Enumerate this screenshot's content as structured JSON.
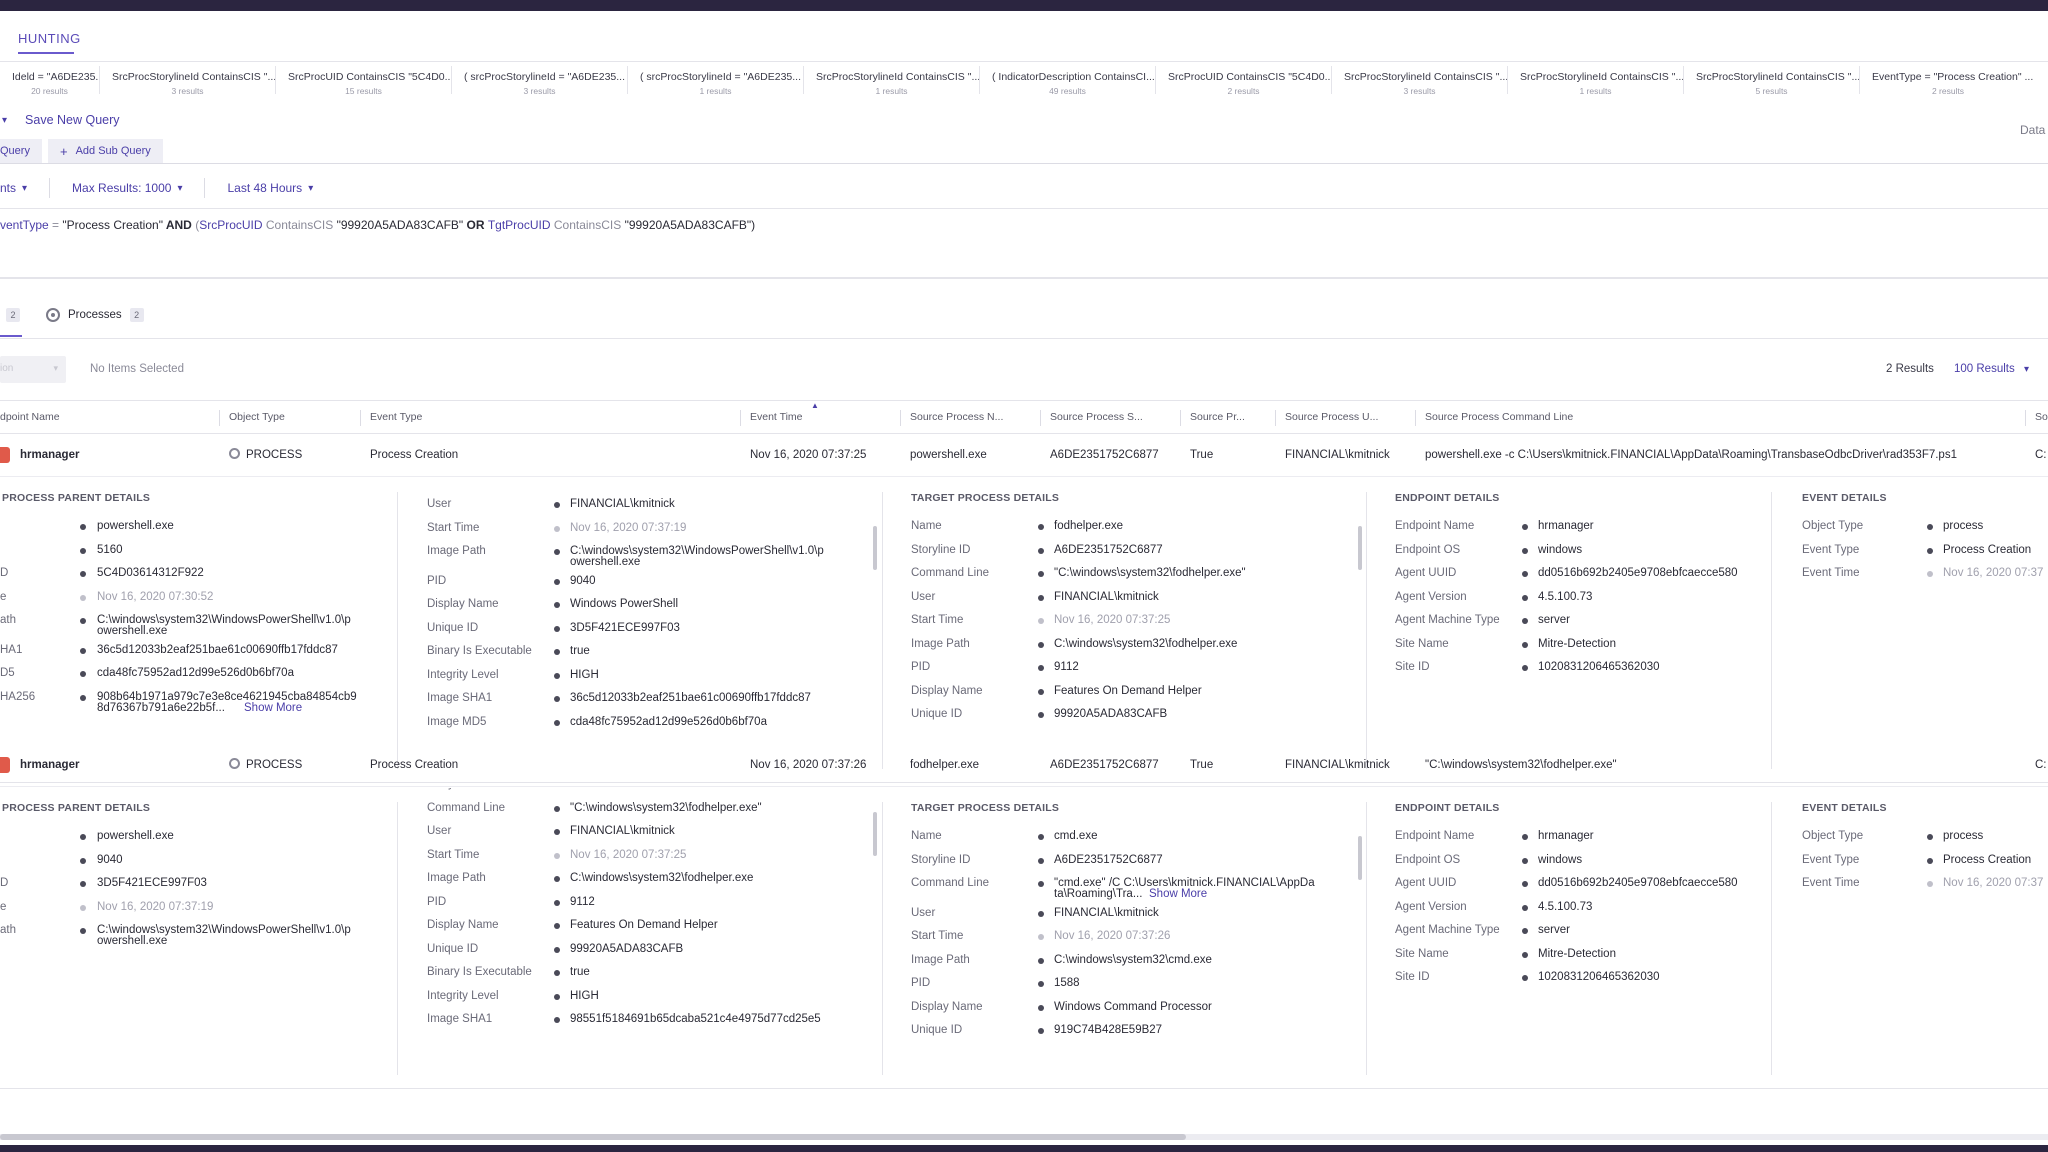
{
  "app": {
    "section_title": "HUNTING"
  },
  "history_tabs": [
    {
      "query": "Ideld = \"A6DE235...",
      "results": "20 results"
    },
    {
      "query": "SrcProcStorylineId ContainsCIS \"...",
      "results": "3 results"
    },
    {
      "query": "SrcProcUID ContainsCIS \"5C4D0...",
      "results": "15 results"
    },
    {
      "query": "( srcProcStorylineId = \"A6DE235...",
      "results": "3 results"
    },
    {
      "query": "( srcProcStorylineId = \"A6DE235...",
      "results": "1 results"
    },
    {
      "query": "SrcProcStorylineId ContainsCIS \"...",
      "results": "1 results"
    },
    {
      "query": "( IndicatorDescription ContainsCI...",
      "results": "49 results"
    },
    {
      "query": "SrcProcUID ContainsCIS \"5C4D0...",
      "results": "2 results"
    },
    {
      "query": "SrcProcStorylineId ContainsCIS \"...",
      "results": "3 results"
    },
    {
      "query": "SrcProcStorylineId ContainsCIS \"...",
      "results": "1 results"
    },
    {
      "query": "SrcProcStorylineId ContainsCIS \"...",
      "results": "5 results"
    },
    {
      "query": "EventType = \"Process Creation\" ...",
      "results": "2 results"
    }
  ],
  "query_actions": {
    "save_new_query": "Save New Query",
    "data_label": "Data"
  },
  "subquery": {
    "query_tab": "Query",
    "add_sub_query": "Add Sub Query"
  },
  "filters": {
    "events": "nts",
    "max_results": "Max Results: 1000",
    "time_range": "Last 48 Hours"
  },
  "query_text": {
    "p1": "ventType",
    "p2": " = ",
    "p3": "\"Process Creation\"",
    "p4": " AND ",
    "p5": "(",
    "p6": "SrcProcUID",
    "p7": " ContainsCIS ",
    "p8": "\"99920A5ADA83CAFB\"",
    "p9": " OR ",
    "p10": "TgtProcUID",
    "p11": " ContainsCIS ",
    "p12": "\"99920A5ADA83CAFB\")"
  },
  "result_tabs": {
    "events_badge": "2",
    "processes_label": "Processes",
    "processes_badge": "2"
  },
  "toolbar": {
    "action_label": "ion",
    "no_items": "No Items Selected",
    "results_count": "2 Results",
    "results_per_page": "100 Results"
  },
  "table": {
    "headers": [
      "dpoint Name",
      "Object Type",
      "Event Type",
      "Event Time",
      "Source Process N...",
      "Source Process S...",
      "Source Pr...",
      "Source Process U...",
      "Source Process Command Line",
      "So"
    ],
    "rows": [
      {
        "endpoint": "hrmanager",
        "object_type": "PROCESS",
        "event_type": "Process Creation",
        "event_time": "Nov 16, 2020 07:37:25",
        "src_name": "powershell.exe",
        "src_storyline": "A6DE2351752C6877",
        "src_pr": "True",
        "src_user": "FINANCIAL\\kmitnick",
        "src_cmd": "powershell.exe -c C:\\Users\\kmitnick.FINANCIAL\\AppData\\Roaming\\TransbaseOdbcDriver\\rad353F7.ps1",
        "extra": "C:",
        "parent": {
          "title": "PROCESS PARENT DETAILS",
          "items": [
            {
              "k": "",
              "v": "powershell.exe"
            },
            {
              "k": "",
              "v": "5160"
            },
            {
              "k": "D",
              "v": "5C4D03614312F922"
            },
            {
              "k": "e",
              "v": "Nov 16, 2020 07:30:52"
            },
            {
              "k": "ath",
              "v": "C:\\windows\\system32\\WindowsPowerShell\\v1.0\\p",
              "v2": "owershell.exe"
            },
            {
              "k": "HA1",
              "v": "36c5d12033b2eaf251bae61c00690ffb17fddc87"
            },
            {
              "k": "D5",
              "v": "cda48fc75952ad12d99e526d0b6bf70a"
            },
            {
              "k": "HA256",
              "v": "908b64b1971a979c7e3e8ce4621945cba84854cb9",
              "v2": "8d76367b791a6e22b5f...",
              "more": "Show More"
            }
          ]
        },
        "source": {
          "items": [
            {
              "k": "User",
              "v": "FINANCIAL\\kmitnick"
            },
            {
              "k": "Start Time",
              "v": "Nov 16, 2020 07:37:19"
            },
            {
              "k": "Image Path",
              "v": "C:\\windows\\system32\\WindowsPowerShell\\v1.0\\p",
              "v2": "owershell.exe"
            },
            {
              "k": "PID",
              "v": "9040"
            },
            {
              "k": "Display Name",
              "v": "Windows PowerShell"
            },
            {
              "k": "Unique ID",
              "v": "3D5F421ECE997F03"
            },
            {
              "k": "Binary Is Executable",
              "v": "true"
            },
            {
              "k": "Integrity Level",
              "v": "HIGH"
            },
            {
              "k": "Image SHA1",
              "v": "36c5d12033b2eaf251bae61c00690ffb17fddc87"
            },
            {
              "k": "Image MD5",
              "v": "cda48fc75952ad12d99e526d0b6bf70a"
            }
          ]
        },
        "target": {
          "title": "TARGET PROCESS DETAILS",
          "items": [
            {
              "k": "Name",
              "v": "fodhelper.exe"
            },
            {
              "k": "Storyline ID",
              "v": "A6DE2351752C6877"
            },
            {
              "k": "Command Line",
              "v": "\"C:\\windows\\system32\\fodhelper.exe\""
            },
            {
              "k": "User",
              "v": "FINANCIAL\\kmitnick"
            },
            {
              "k": "Start Time",
              "v": "Nov 16, 2020 07:37:25"
            },
            {
              "k": "Image Path",
              "v": "C:\\windows\\system32\\fodhelper.exe"
            },
            {
              "k": "PID",
              "v": "9112"
            },
            {
              "k": "Display Name",
              "v": "Features On Demand Helper"
            },
            {
              "k": "Unique ID",
              "v": "99920A5ADA83CAFB"
            }
          ]
        },
        "endpoint_details": {
          "title": "ENDPOINT DETAILS",
          "items": [
            {
              "k": "Endpoint Name",
              "v": "hrmanager"
            },
            {
              "k": "Endpoint OS",
              "v": "windows"
            },
            {
              "k": "Agent UUID",
              "v": "dd0516b692b2405e9708ebfcaecce580"
            },
            {
              "k": "Agent Version",
              "v": "4.5.100.73"
            },
            {
              "k": "Agent Machine Type",
              "v": "server"
            },
            {
              "k": "Site Name",
              "v": "Mitre-Detection"
            },
            {
              "k": "Site ID",
              "v": "1020831206465362030"
            }
          ]
        },
        "event_details": {
          "title": "EVENT DETAILS",
          "items": [
            {
              "k": "Object Type",
              "v": "process"
            },
            {
              "k": "Event Type",
              "v": "Process Creation"
            },
            {
              "k": "Event Time",
              "v": "Nov 16, 2020 07:37"
            }
          ]
        }
      },
      {
        "endpoint": "hrmanager",
        "object_type": "PROCESS",
        "event_type": "Process Creation",
        "event_time": "Nov 16, 2020 07:37:26",
        "src_name": "fodhelper.exe",
        "src_storyline": "A6DE2351752C6877",
        "src_pr": "True",
        "src_user": "FINANCIAL\\kmitnick",
        "src_cmd": "\"C:\\windows\\system32\\fodhelper.exe\"",
        "extra": "C:",
        "parent": {
          "title": "PROCESS PARENT DETAILS",
          "items": [
            {
              "k": "",
              "v": "powershell.exe"
            },
            {
              "k": "",
              "v": "9040"
            },
            {
              "k": "D",
              "v": "3D5F421ECE997F03"
            },
            {
              "k": "e",
              "v": "Nov 16, 2020 07:37:19"
            },
            {
              "k": "ath",
              "v": "C:\\windows\\system32\\WindowsPowerShell\\v1.0\\p",
              "v2": "owershell.exe"
            }
          ]
        },
        "source": {
          "items": [
            {
              "k": "Storyline ID",
              "v": "A6DE2351752C6877"
            },
            {
              "k": "Command Line",
              "v": "\"C:\\windows\\system32\\fodhelper.exe\""
            },
            {
              "k": "User",
              "v": "FINANCIAL\\kmitnick"
            },
            {
              "k": "Start Time",
              "v": "Nov 16, 2020 07:37:25"
            },
            {
              "k": "Image Path",
              "v": "C:\\windows\\system32\\fodhelper.exe"
            },
            {
              "k": "PID",
              "v": "9112"
            },
            {
              "k": "Display Name",
              "v": "Features On Demand Helper"
            },
            {
              "k": "Unique ID",
              "v": "99920A5ADA83CAFB"
            },
            {
              "k": "Binary Is Executable",
              "v": "true"
            },
            {
              "k": "Integrity Level",
              "v": "HIGH"
            },
            {
              "k": "Image SHA1",
              "v": "98551f5184691b65dcaba521c4e4975d77cd25e5"
            }
          ]
        },
        "target": {
          "title": "TARGET PROCESS DETAILS",
          "items": [
            {
              "k": "Name",
              "v": "cmd.exe"
            },
            {
              "k": "Storyline ID",
              "v": "A6DE2351752C6877"
            },
            {
              "k": "Command Line",
              "v": "\"cmd.exe\" /C C:\\Users\\kmitnick.FINANCIAL\\AppDa",
              "v2": "ta\\Roaming\\Tra...",
              "more": "Show More"
            },
            {
              "k": "User",
              "v": "FINANCIAL\\kmitnick"
            },
            {
              "k": "Start Time",
              "v": "Nov 16, 2020 07:37:26"
            },
            {
              "k": "Image Path",
              "v": "C:\\windows\\system32\\cmd.exe"
            },
            {
              "k": "PID",
              "v": "1588"
            },
            {
              "k": "Display Name",
              "v": "Windows Command Processor"
            },
            {
              "k": "Unique ID",
              "v": "919C74B428E59B27"
            }
          ]
        },
        "endpoint_details": {
          "title": "ENDPOINT DETAILS",
          "items": [
            {
              "k": "Endpoint Name",
              "v": "hrmanager"
            },
            {
              "k": "Endpoint OS",
              "v": "windows"
            },
            {
              "k": "Agent UUID",
              "v": "dd0516b692b2405e9708ebfcaecce580"
            },
            {
              "k": "Agent Version",
              "v": "4.5.100.73"
            },
            {
              "k": "Agent Machine Type",
              "v": "server"
            },
            {
              "k": "Site Name",
              "v": "Mitre-Detection"
            },
            {
              "k": "Site ID",
              "v": "1020831206465362030"
            }
          ]
        },
        "event_details": {
          "title": "EVENT DETAILS",
          "items": [
            {
              "k": "Object Type",
              "v": "process"
            },
            {
              "k": "Event Type",
              "v": "Process Creation"
            },
            {
              "k": "Event Time",
              "v": "Nov 16, 2020 07:37"
            }
          ]
        }
      }
    ]
  }
}
